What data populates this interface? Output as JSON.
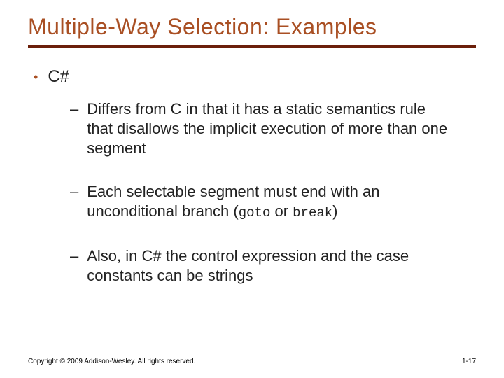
{
  "title": "Multiple-Way Selection: Examples",
  "bullets": {
    "l1": "C#",
    "sub1_a": "Differs from C in that it has a static semantics rule that disallows the implicit execution of more than one segment",
    "sub2_a": "Each selectable segment must end with an unconditional branch (",
    "sub2_code1": "goto",
    "sub2_b": " or ",
    "sub2_code2": "break",
    "sub2_c": ")",
    "sub3_a": "Also, in C# the control expression and the case constants can be strings"
  },
  "footer": {
    "copyright": "Copyright © 2009 Addison-Wesley. All rights reserved.",
    "pagenum": "1-17"
  }
}
